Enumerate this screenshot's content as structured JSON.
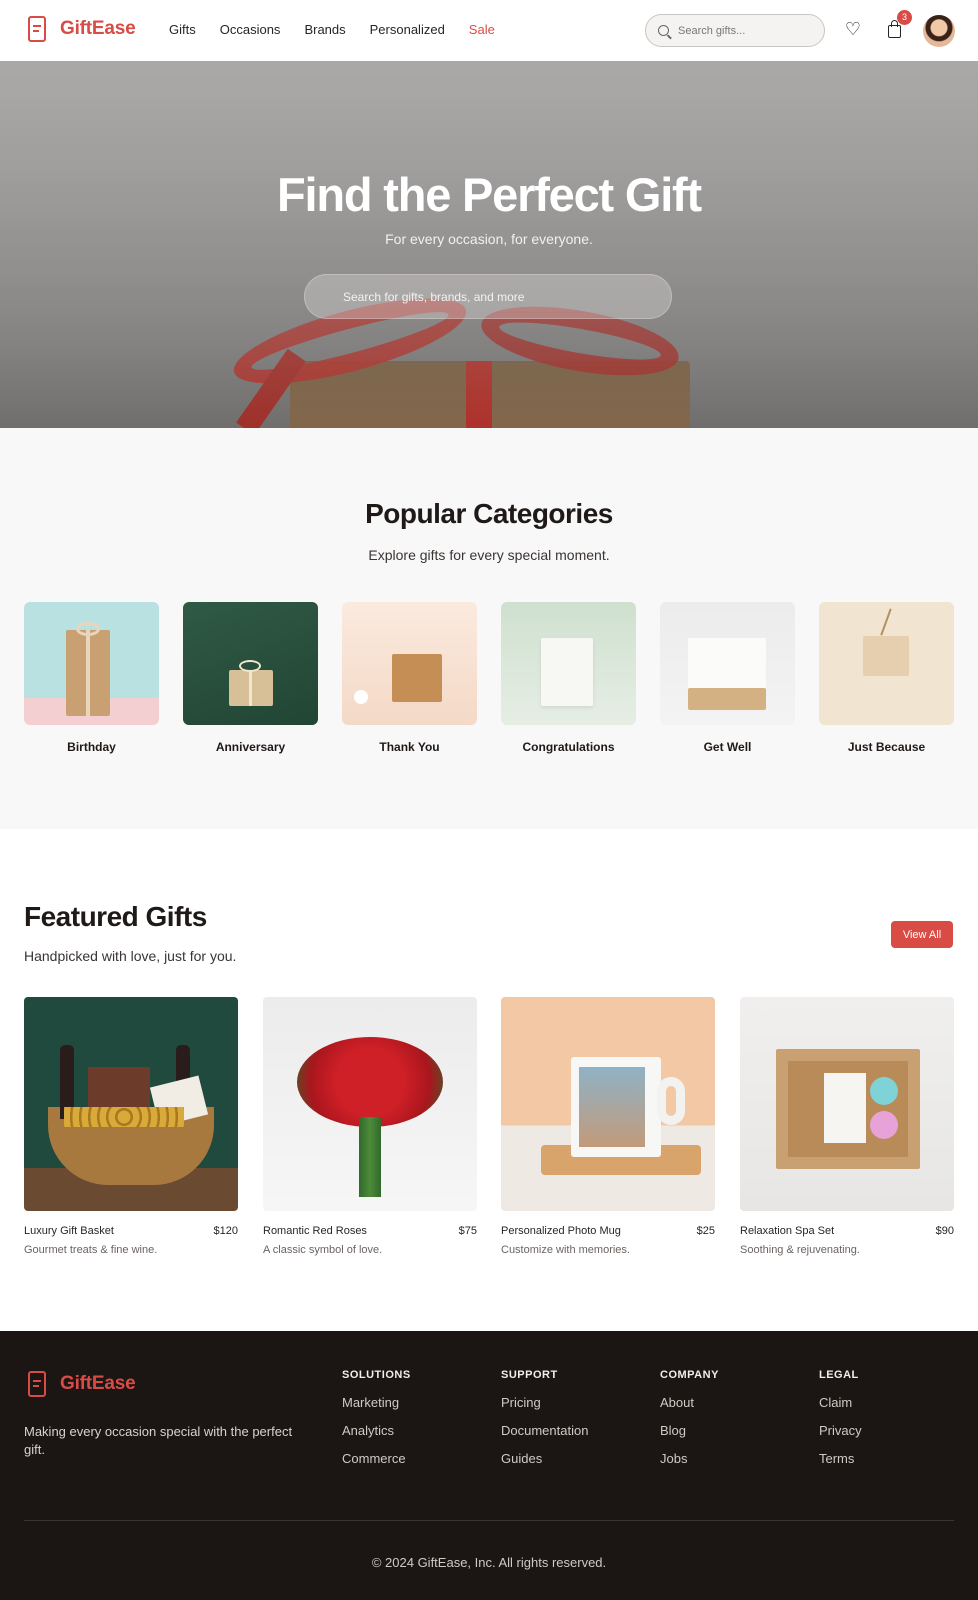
{
  "brand": {
    "name": "GiftEase",
    "accent": "#d94b45"
  },
  "nav": {
    "items": [
      "Gifts",
      "Occasions",
      "Brands",
      "Personalized",
      "Sale"
    ]
  },
  "header": {
    "search_placeholder": "Search gifts...",
    "cart_count": "3",
    "heart_icon": "heart-icon",
    "bag_icon": "shopping-bag-icon"
  },
  "hero": {
    "title": "Find the Perfect Gift",
    "subtitle": "For every occasion, for everyone.",
    "search_placeholder": "Search for gifts, brands, and more"
  },
  "categories": {
    "title": "Popular Categories",
    "subtitle": "Explore gifts for every special moment.",
    "items": [
      {
        "label": "Birthday"
      },
      {
        "label": "Anniversary"
      },
      {
        "label": "Thank You"
      },
      {
        "label": "Congratulations"
      },
      {
        "label": "Get Well"
      },
      {
        "label": "Just Because"
      }
    ]
  },
  "featured": {
    "title": "Featured Gifts",
    "subtitle": "Handpicked with love, just for you.",
    "view_all": "View All",
    "products": [
      {
        "name": "Luxury Gift Basket",
        "price": "$120",
        "desc": "Gourmet treats & fine wine."
      },
      {
        "name": "Romantic Red Roses",
        "price": "$75",
        "desc": "A classic symbol of love."
      },
      {
        "name": "Personalized Photo Mug",
        "price": "$25",
        "desc": "Customize with memories."
      },
      {
        "name": "Relaxation Spa Set",
        "price": "$90",
        "desc": "Soothing & rejuvenating."
      }
    ]
  },
  "footer": {
    "tagline": "Making every occasion special with the perfect gift.",
    "columns": [
      {
        "title": "SOLUTIONS",
        "links": [
          "Marketing",
          "Analytics",
          "Commerce"
        ]
      },
      {
        "title": "SUPPORT",
        "links": [
          "Pricing",
          "Documentation",
          "Guides"
        ]
      },
      {
        "title": "COMPANY",
        "links": [
          "About",
          "Blog",
          "Jobs"
        ]
      },
      {
        "title": "LEGAL",
        "links": [
          "Claim",
          "Privacy",
          "Terms"
        ]
      }
    ],
    "copyright": "© 2024 GiftEase, Inc. All rights reserved."
  }
}
